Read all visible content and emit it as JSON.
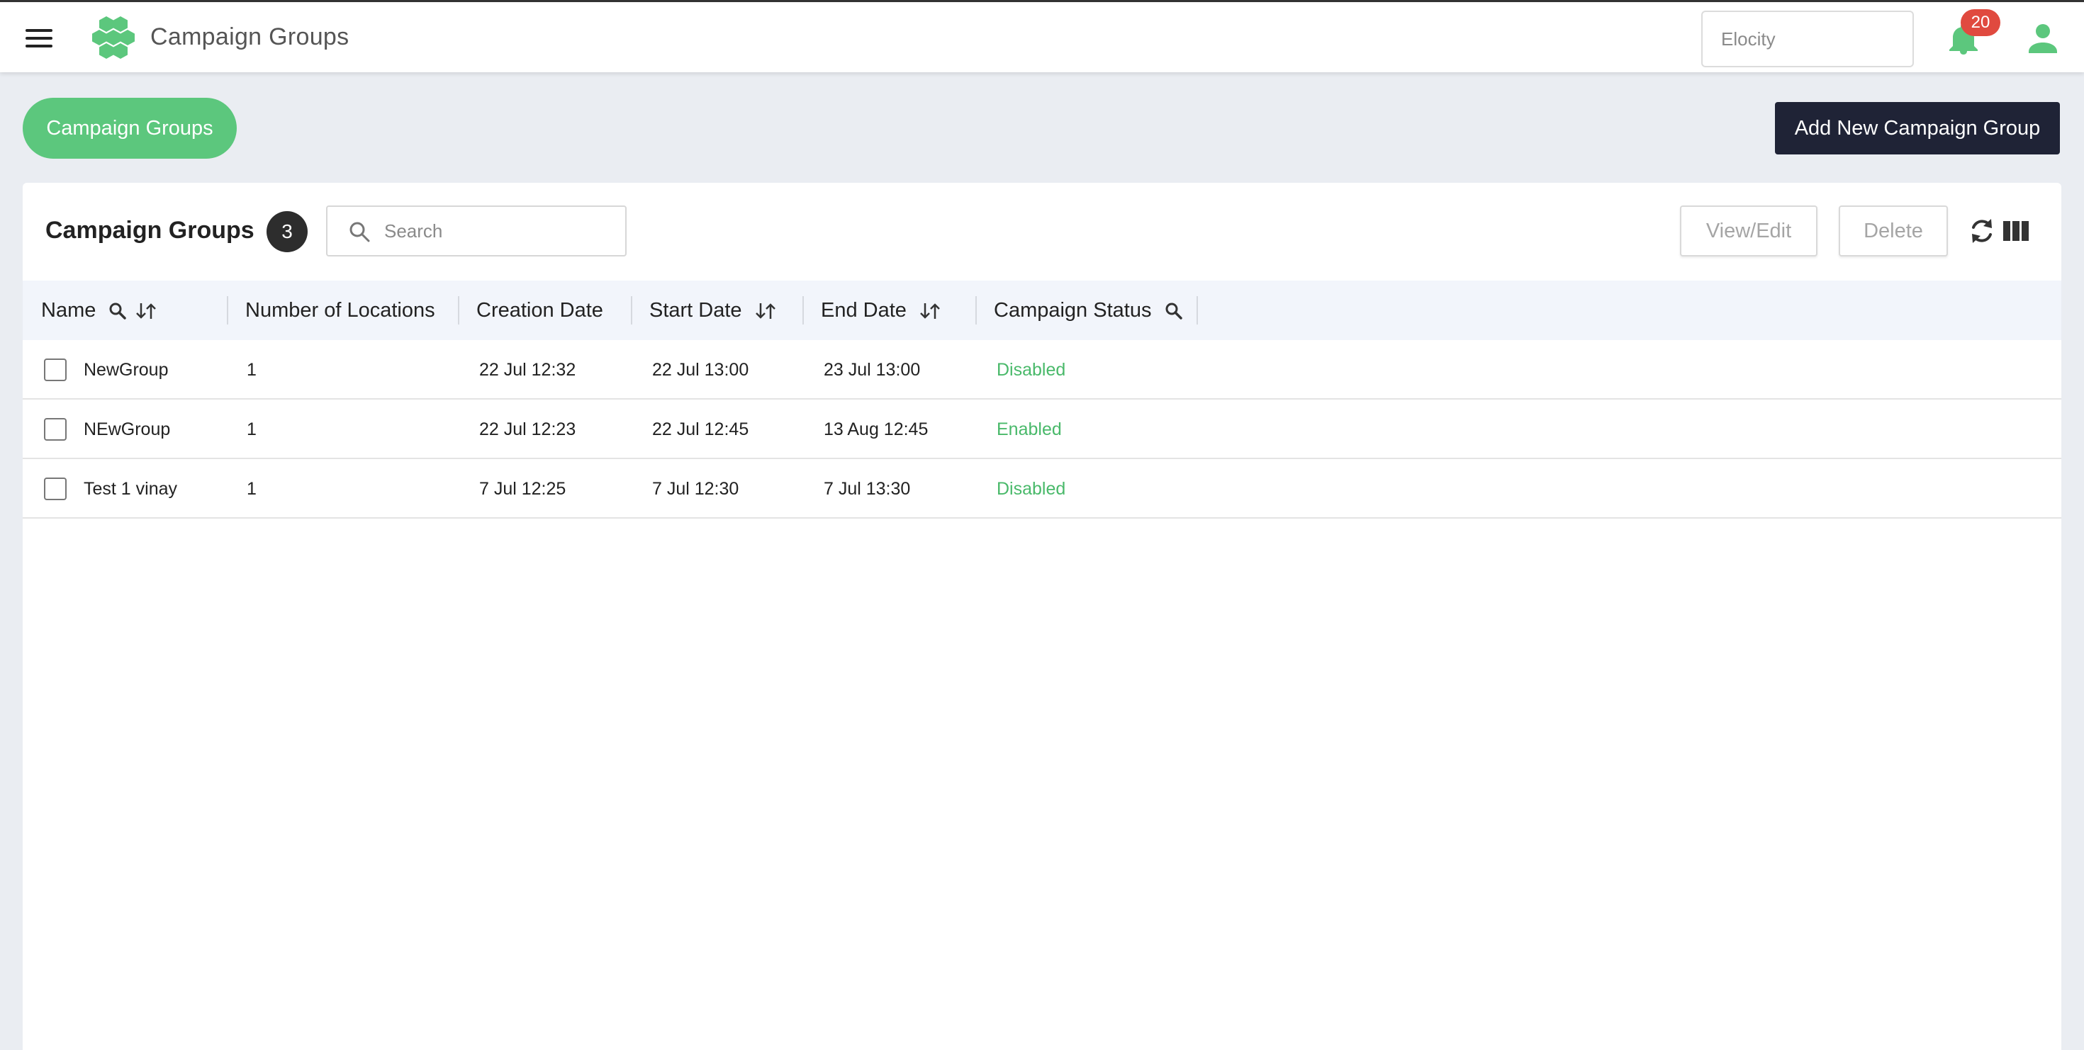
{
  "header": {
    "app_title": "Campaign Groups",
    "tenant_placeholder": "Elocity",
    "notification_count": "20",
    "accent_color": "#5cc77d"
  },
  "subheader": {
    "breadcrumb_label": "Campaign Groups",
    "add_button_label": "Add New Campaign Group"
  },
  "card": {
    "title": "Campaign Groups",
    "count": "3",
    "search_placeholder": "Search",
    "view_edit_label": "View/Edit",
    "delete_label": "Delete"
  },
  "table": {
    "columns": [
      {
        "label": "Name",
        "searchable": true,
        "sortable": true
      },
      {
        "label": "Number of Locations",
        "searchable": false,
        "sortable": false
      },
      {
        "label": "Creation Date",
        "searchable": false,
        "sortable": false
      },
      {
        "label": "Start Date",
        "searchable": false,
        "sortable": true
      },
      {
        "label": "End Date",
        "searchable": false,
        "sortable": true
      },
      {
        "label": "Campaign Status",
        "searchable": true,
        "sortable": false
      }
    ],
    "rows": [
      {
        "name": "NewGroup",
        "locations": "1",
        "created": "22 Jul 12:32",
        "start": "22 Jul 13:00",
        "end": "23 Jul 13:00",
        "status": "Disabled"
      },
      {
        "name": "NEwGroup",
        "locations": "1",
        "created": "22 Jul 12:23",
        "start": "22 Jul 12:45",
        "end": "13 Aug 12:45",
        "status": "Enabled"
      },
      {
        "name": "Test 1 vinay",
        "locations": "1",
        "created": "7 Jul 12:25",
        "start": "7 Jul 12:30",
        "end": "7 Jul 13:30",
        "status": "Disabled"
      }
    ]
  }
}
